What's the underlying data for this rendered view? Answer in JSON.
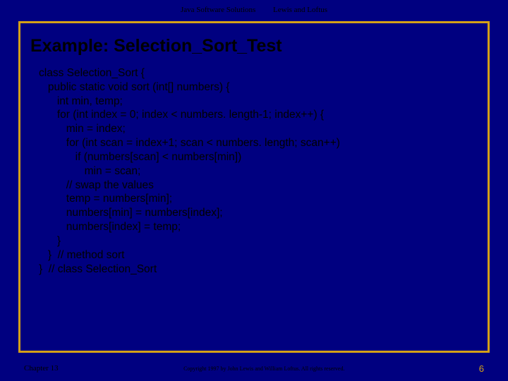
{
  "header": {
    "book": "Java Software Solutions",
    "authors": "Lewis and Loftus"
  },
  "title": "Example: Selection_Sort_Test",
  "code": {
    "l01": "class Selection_Sort {",
    "l02": "   public static void sort (int[] numbers) {",
    "l03": "      int min, temp;",
    "l04": "      for (int index = 0; index < numbers. length-1; index++) {",
    "l05": "         min = index;",
    "l06": "         for (int scan = index+1; scan < numbers. length; scan++)",
    "l07": "            if (numbers[scan] < numbers[min])",
    "l08": "               min = scan;",
    "l09": "         // swap the values",
    "l10": "         temp = numbers[min];",
    "l11": "         numbers[min] = numbers[index];",
    "l12": "         numbers[index] = temp;",
    "l13": "      }",
    "l14": "   }  // method sort",
    "l15": "}  // class Selection_Sort"
  },
  "footer": {
    "chapter": "Chapter 13",
    "copyright": "Copyright 1997 by John Lewis and William Loftus.  All rights reserved.",
    "page": "6"
  }
}
